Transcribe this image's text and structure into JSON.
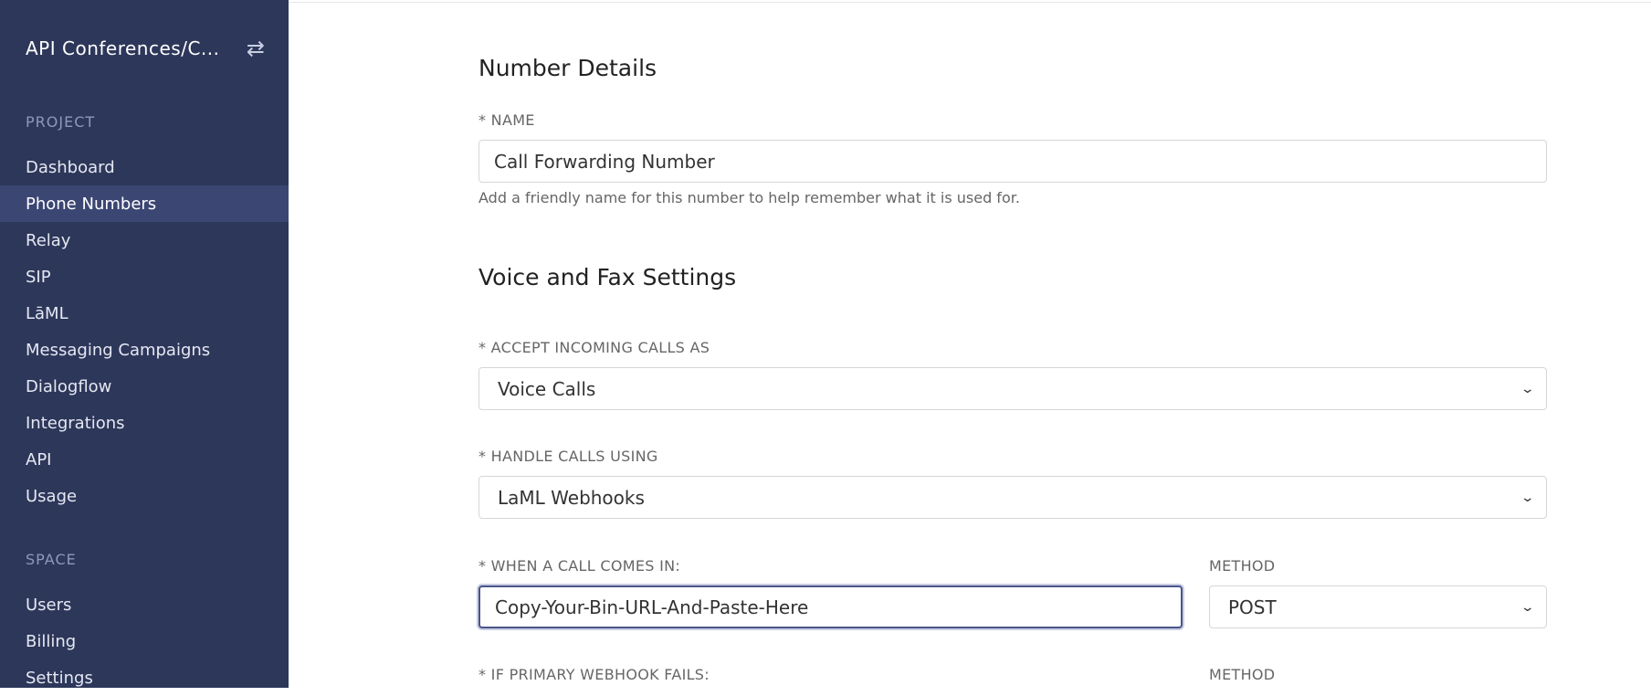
{
  "sidebar": {
    "project_name": "API Conferences/C...",
    "switch_icon": "arrows-swap-icon",
    "sections": [
      {
        "label": "PROJECT",
        "items": [
          {
            "label": "Dashboard",
            "active": false
          },
          {
            "label": "Phone Numbers",
            "active": true
          },
          {
            "label": "Relay",
            "active": false
          },
          {
            "label": "SIP",
            "active": false
          },
          {
            "label": "LāML",
            "active": false
          },
          {
            "label": "Messaging Campaigns",
            "active": false
          },
          {
            "label": "Dialogflow",
            "active": false
          },
          {
            "label": "Integrations",
            "active": false
          },
          {
            "label": "API",
            "active": false
          },
          {
            "label": "Usage",
            "active": false
          }
        ]
      },
      {
        "label": "SPACE",
        "items": [
          {
            "label": "Users",
            "active": false
          },
          {
            "label": "Billing",
            "active": false
          },
          {
            "label": "Settings",
            "active": false
          }
        ]
      }
    ]
  },
  "number_details": {
    "heading": "Number Details",
    "name_label": "* NAME",
    "name_value": "Call Forwarding Number",
    "name_help": "Add a friendly name for this number to help remember what it is used for."
  },
  "voice_fax": {
    "heading": "Voice and Fax Settings",
    "accept_label": "* ACCEPT INCOMING CALLS AS",
    "accept_value": "Voice Calls",
    "handle_label": "* HANDLE CALLS USING",
    "handle_value": "LaML Webhooks",
    "call_in_label": "* WHEN A CALL COMES IN:",
    "call_in_value": "Copy-Your-Bin-URL-And-Paste-Here",
    "method_label": "METHOD",
    "method_value": "POST",
    "fail_label": "* IF PRIMARY WEBHOOK FAILS:",
    "fail_method_label": "METHOD"
  },
  "colors": {
    "sidebar_bg": "#2d375a",
    "sidebar_active": "#3b4673",
    "focus_border": "#4a5488"
  }
}
